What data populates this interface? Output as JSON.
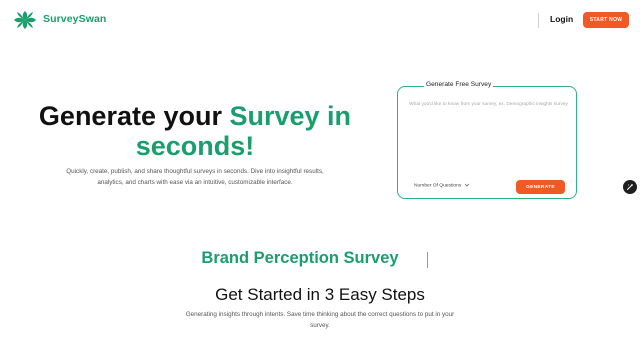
{
  "nav": {
    "brand": "SurveySwan",
    "login_label": "Login",
    "cta_label": "START NOW"
  },
  "hero": {
    "title_part1": "Generate your ",
    "title_accent": "Survey in",
    "title_line2": "seconds!",
    "description": "Quickly, create, publish, and share thoughtful surveys in seconds. Dive into insightful results, analytics, and charts with ease via an intuitive, customizable interface."
  },
  "generator": {
    "legend": "Generate Free Survey",
    "placeholder": "What you'd like to know from your survey, ex. Demographic insights survey",
    "questions_label": "Number Of Questions",
    "generate_label": "GENERATE"
  },
  "section": {
    "typing_text": "Brand Perception Survey",
    "steps_title": "Get Started in 3 Easy Steps",
    "steps_description": "Generating insights through intents. Save time thinking about the correct questions to put in your survey."
  },
  "colors": {
    "brand_green": "#1a9e6e",
    "accent_orange": "#f15a24"
  },
  "icons": {
    "logo": "swan-flower-logo-icon",
    "chevron": "chevron-down-icon",
    "fab": "magic-wand-icon"
  }
}
